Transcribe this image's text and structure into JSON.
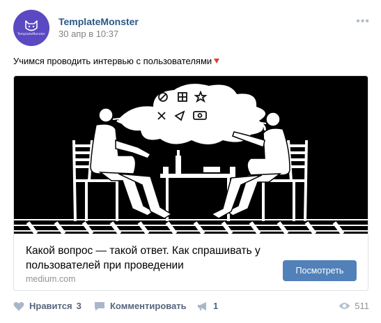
{
  "post": {
    "author": "TemplateMonster",
    "date": "30 апр в 10:37",
    "avatar_text": "TemplateMonster",
    "text": "Учимся проводить интервью с пользователями",
    "more_icon": "more-dots-icon"
  },
  "card": {
    "title": "Какой вопрос — такой ответ. Как спрашивать у пользователей при проведении",
    "domain": "medium.com",
    "button_label": "Посмотреть"
  },
  "actions": {
    "like_label": "Нравится",
    "like_count": "3",
    "comment_label": "Комментировать",
    "share_count": "1",
    "views_count": "511"
  },
  "colors": {
    "author": "#2a5885",
    "button": "#5181b8",
    "avatar": "#5b49c2"
  }
}
